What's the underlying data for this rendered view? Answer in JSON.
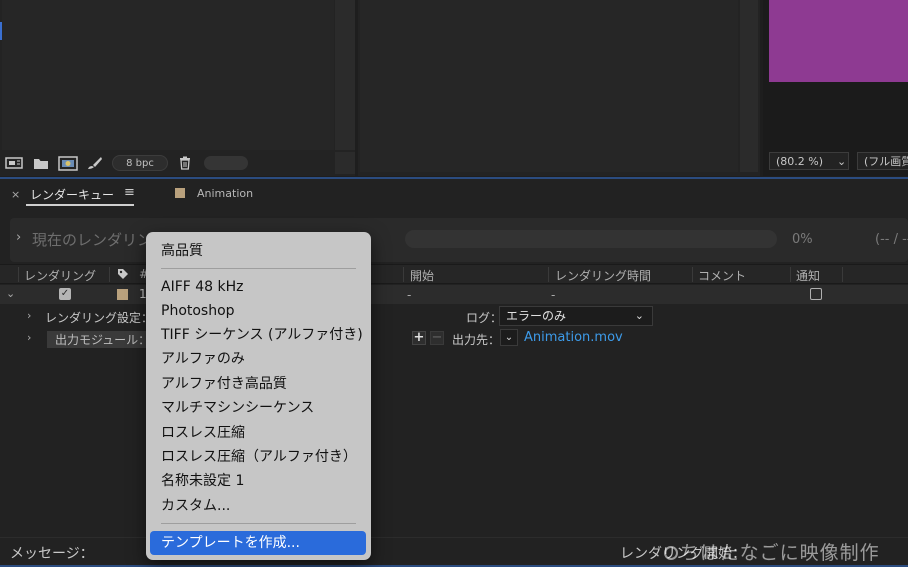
{
  "top_left_panel": {
    "bpc_label": "8 bpc",
    "icons": [
      "interpret-footage-icon",
      "new-folder-icon",
      "new-composition-icon",
      "brush-icon",
      "trash-icon"
    ]
  },
  "viewer_panel": {
    "swatch_color": "#8e3a92",
    "zoom_value": "(80.2 %)",
    "resolution_value": "(フル画質)"
  },
  "render_queue": {
    "tab_title": "レンダーキュー",
    "comp_tab_title": "Animation",
    "comp_color": "#b9a17d",
    "current_render_label": "現在のレンダリング",
    "progress_percent": "0%",
    "progress_end": "(-- / --)",
    "columns": {
      "render": "レンダリング",
      "hash": "#",
      "start": "開始",
      "render_time": "レンダリング時間",
      "comment": "コメント",
      "notify": "通知"
    },
    "item": {
      "number": "1",
      "start_value": "-",
      "render_time_value": "-",
      "render_checked": true,
      "notify_checked": false
    },
    "render_settings_label": "レンダリング設定：",
    "output_module_label": "出力モジュール：",
    "log_label": "ログ：",
    "log_value": "エラーのみ",
    "output_to_label": "出力先：",
    "output_file": "Animation.mov",
    "message_label": "メッセージ：",
    "render_start_label": "レンダリング開始：",
    "watermark": "ちはたなごに映像制作"
  },
  "output_module_menu": {
    "header_item": "高品質",
    "items": [
      "AIFF 48 kHz",
      "Photoshop",
      "TIFF シーケンス (アルファ付き)",
      "アルファのみ",
      "アルファ付き高品質",
      "マルチマシンシーケンス",
      "ロスレス圧縮",
      "ロスレス圧縮（アルファ付き）",
      "名称未設定 1",
      "カスタム..."
    ],
    "selected_item": "テンプレートを作成..."
  },
  "colors": {
    "accent_blue": "#2a6bdb",
    "link_blue": "#3d9be9"
  }
}
